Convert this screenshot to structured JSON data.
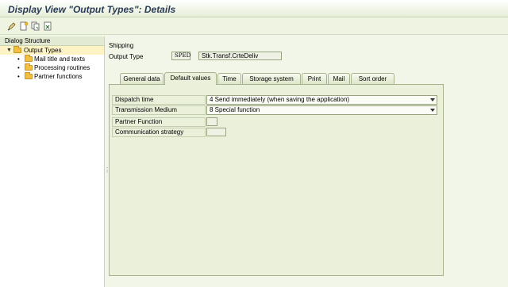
{
  "window": {
    "title": "Display View \"Output Types\": Details"
  },
  "toolbar": {
    "buttons": [
      "edit-icon",
      "new-entries-icon",
      "copy-icon",
      "delete-icon"
    ]
  },
  "dialog_structure": {
    "header": "Dialog Structure",
    "items": [
      {
        "label": "Output Types",
        "level": 0,
        "expanded": true,
        "selected": true
      },
      {
        "label": "Mail title and texts",
        "level": 1
      },
      {
        "label": "Processing routines",
        "level": 1
      },
      {
        "label": "Partner functions",
        "level": 1
      }
    ]
  },
  "header": {
    "application": "Shipping",
    "output_type_label": "Output Type",
    "output_type_code": "SPED",
    "output_type_desc": "Stk.Transf.CrteDeliv"
  },
  "tabs": [
    {
      "label": "General data",
      "active": false
    },
    {
      "label": "Default values",
      "active": true
    },
    {
      "label": "Time",
      "active": false
    },
    {
      "label": "Storage system",
      "active": false
    },
    {
      "label": "Print",
      "active": false
    },
    {
      "label": "Mail",
      "active": false
    },
    {
      "label": "Sort order",
      "active": false
    }
  ],
  "fields": {
    "dispatch_time": {
      "label": "Dispatch time",
      "value": "4 Send immediately (when saving the application)"
    },
    "transmission_medium": {
      "label": "Transmission Medium",
      "value": "8 Special function"
    },
    "partner_function": {
      "label": "Partner Function",
      "value": ""
    },
    "communication_strategy": {
      "label": "Communication strategy",
      "value": ""
    }
  },
  "colors": {
    "background": "#f2f6e8",
    "title": "#2b3a55",
    "selection": "#fdf3c4",
    "folder": "#f2c040"
  }
}
